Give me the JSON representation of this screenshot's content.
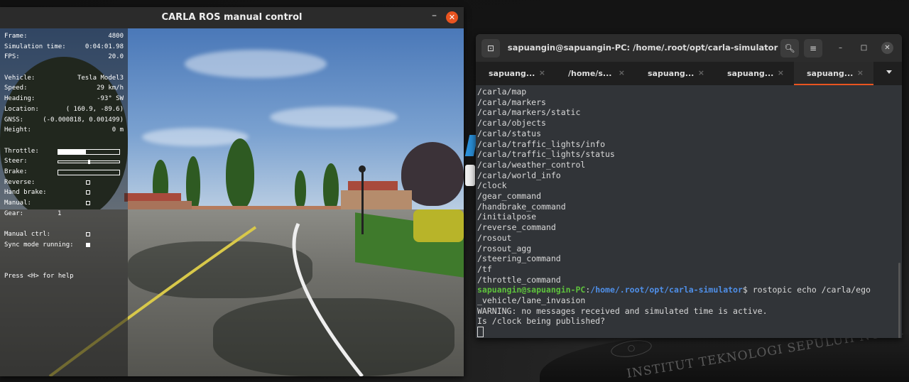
{
  "carla": {
    "title": "CARLA ROS manual control",
    "minimize": "–",
    "close": "✕",
    "hud": {
      "rows_a": [
        {
          "key": "Frame:",
          "value": "4800"
        },
        {
          "key": "Simulation time:",
          "value": "0:04:01.98"
        },
        {
          "key": "FPS:",
          "value": "20.0"
        }
      ],
      "rows_b": [
        {
          "key": "Vehicle:",
          "value": "Tesla Model3"
        },
        {
          "key": "Speed:",
          "value": "29 km/h"
        },
        {
          "key": "Heading:",
          "value": "-93° SW"
        },
        {
          "key": "Location:",
          "value": "( 160.9, -89.6)"
        },
        {
          "key": "GNSS:",
          "value": "(-0.000818, 0.001499)"
        },
        {
          "key": "Height:",
          "value": "0 m"
        }
      ],
      "throttle_label": "Throttle:",
      "throttle_value": 0.45,
      "steer_label": "Steer:",
      "steer_value": 0.02,
      "brake_label": "Brake:",
      "brake_value": 0.0,
      "reverse_label": "Reverse:",
      "reverse_on": false,
      "handbrake_label": "Hand brake:",
      "handbrake_on": false,
      "manual_label": "Manual:",
      "manual_on": false,
      "gear_label": "Gear:",
      "gear_value": "1",
      "manual_ctrl_label": "Manual ctrl:",
      "manual_ctrl_on": false,
      "sync_label": "Sync mode running:",
      "sync_on": true,
      "help_text": "Press <H> for help"
    }
  },
  "terminal": {
    "title": "sapuangin@sapuangin-PC: /home/.root/opt/carla-simulator",
    "new_tab_icon": "new-tab-icon",
    "tabs": [
      {
        "label": "sapuang..."
      },
      {
        "label": "/home/s..."
      },
      {
        "label": "sapuang..."
      },
      {
        "label": "sapuang..."
      },
      {
        "label": "sapuang...",
        "active": true
      }
    ],
    "tab_close": "×",
    "lines": [
      "/carla/map",
      "/carla/markers",
      "/carla/markers/static",
      "/carla/objects",
      "/carla/status",
      "/carla/traffic_lights/info",
      "/carla/traffic_lights/status",
      "/carla/weather_control",
      "/carla/world_info",
      "/clock",
      "/gear_command",
      "/handbrake_command",
      "/initialpose",
      "/reverse_command",
      "/rosout",
      "/rosout_agg",
      "/steering_command",
      "/tf",
      "/throttle_command"
    ],
    "prompt_user": "sapuangin@sapuangin-PC",
    "prompt_sep": ":",
    "prompt_path": "/home/.root/opt/carla-simulator",
    "prompt_command": "$ rostopic echo /carla/ego",
    "command_wrap": "_vehicle/lane_invasion",
    "warning": "WARNING: no messages received and simulated time is active.",
    "question": "Is /clock being published?"
  },
  "desktop": {
    "watermark": "INSTITUT TEKNOLOGI SEPULUH NOPEMBER"
  }
}
